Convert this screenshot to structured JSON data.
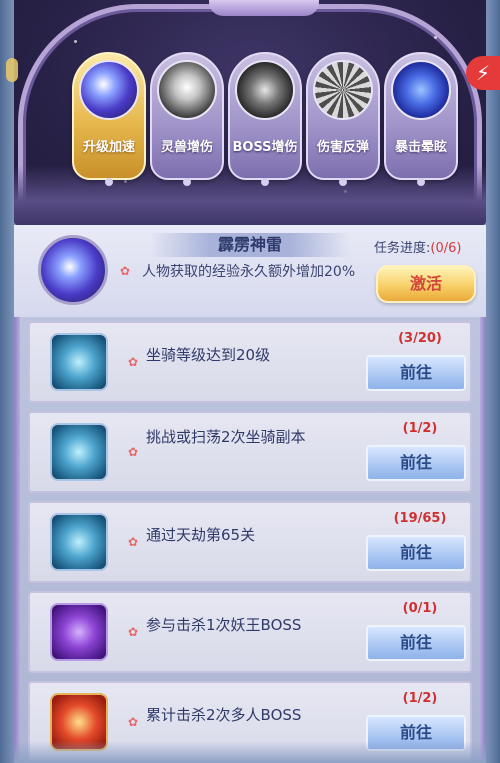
{
  "tabs": [
    {
      "label": "升级加速",
      "active": true,
      "icon": "purple-thunder-icon"
    },
    {
      "label": "灵兽增伤",
      "active": false,
      "icon": "white-fang-icon"
    },
    {
      "label": "BOSS增伤",
      "active": false,
      "icon": "storm-icon"
    },
    {
      "label": "伤害反弹",
      "active": false,
      "icon": "radiant-burst-icon"
    },
    {
      "label": "暴击晕眩",
      "active": false,
      "icon": "galaxy-orb-icon"
    }
  ],
  "skill": {
    "name": "霹雳神雷",
    "description": "人物获取的经验永久额外增加20%",
    "progress_label": "任务进度:",
    "progress_value": "(0/6)",
    "activate_label": "激活"
  },
  "tasks": [
    {
      "text": "坐骑等级达到20级",
      "progress": "(3/20)",
      "button": "前往",
      "icon": "mount-orb-icon"
    },
    {
      "text": "挑战或扫荡2次坐骑副本",
      "progress": "(1/2)",
      "button": "前往",
      "icon": "mount-orb-icon"
    },
    {
      "text": "通过天劫第65关",
      "progress": "(19/65)",
      "button": "前往",
      "icon": "mount-orb-icon"
    },
    {
      "text": "参与击杀1次妖王BOSS",
      "progress": "(0/1)",
      "button": "前往",
      "icon": "demon-king-icon"
    },
    {
      "text": "累计击杀2次多人BOSS",
      "progress": "(1/2)",
      "button": "前往",
      "icon": "dragon-icon"
    }
  ],
  "colors": {
    "progress_red": "#d0302f",
    "active_tab_gold": "#e6b84e",
    "go_button_blue": "#a9c6f2"
  }
}
